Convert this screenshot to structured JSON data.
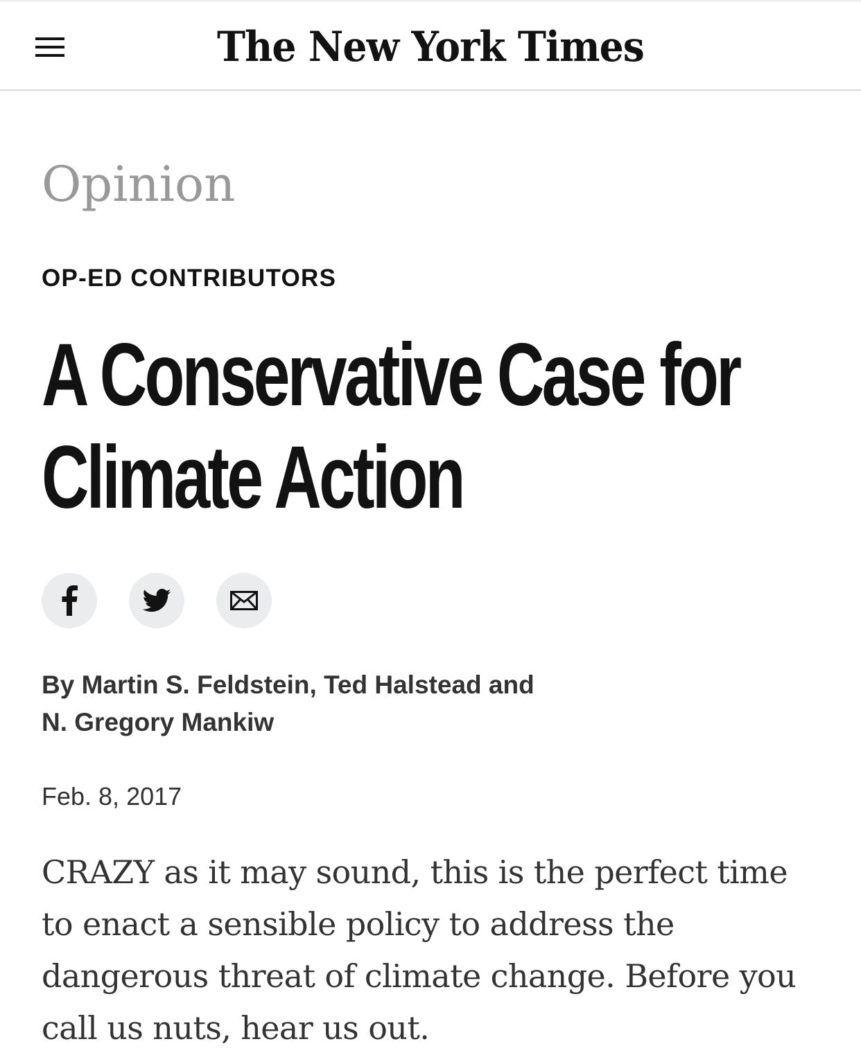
{
  "header": {
    "menu_icon": "hamburger-menu-icon",
    "masthead": "The New York Times"
  },
  "article": {
    "section": "Opinion",
    "kicker": "OP-ED CONTRIBUTORS",
    "headline_line1": "A Conservative Case for",
    "headline_line2": "Climate Action",
    "share_buttons": [
      {
        "icon": "facebook-icon",
        "label": "f"
      },
      {
        "icon": "twitter-icon"
      },
      {
        "icon": "email-icon"
      }
    ],
    "byline_line1": "By Martin S. Feldstein, Ted Halstead and",
    "byline_line2": "N. Gregory Mankiw",
    "date": "Feb. 8, 2017",
    "body_paragraph": "CRAZY as it may sound, this is the perfect time to enact a sensible policy to address the dangerous threat of climate change. Before you call us nuts, hear us out."
  },
  "colors": {
    "text_primary": "#121212",
    "text_secondary": "#333333",
    "section_gray": "#999999",
    "share_button_bg": "#eaeced",
    "divider": "#d9d9d9"
  }
}
